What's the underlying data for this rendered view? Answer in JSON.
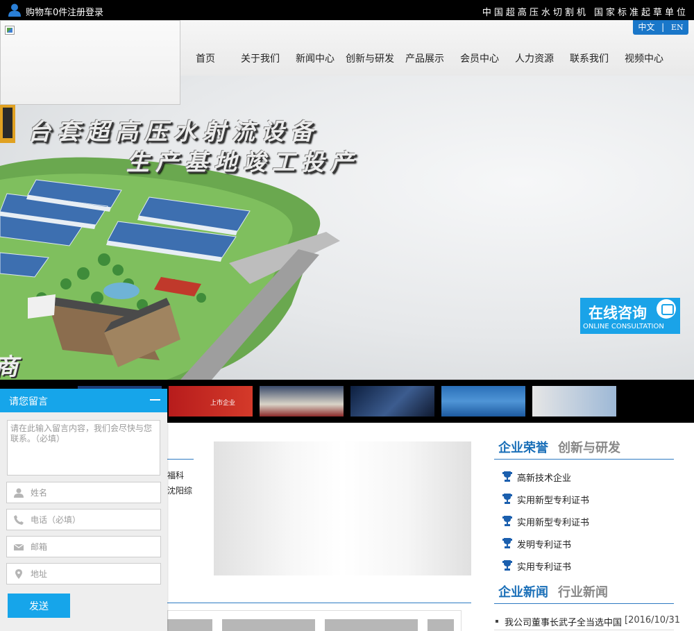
{
  "topbar": {
    "cart": "购物车0件",
    "login": "注册登录",
    "slogan": "中国超高压水切割机 国家标准起草单位"
  },
  "lang": {
    "zh": "中文",
    "sep": "|",
    "en": "EN"
  },
  "nav": {
    "items": [
      {
        "label": "首页"
      },
      {
        "label": "关于我们"
      },
      {
        "label": "新闻中心"
      },
      {
        "label": "创新与研发"
      },
      {
        "label": "产品展示"
      },
      {
        "label": "会员中心"
      },
      {
        "label": "人力资源"
      },
      {
        "label": "联系我们"
      },
      {
        "label": "视频中心"
      }
    ]
  },
  "hero": {
    "headline1": "台套超高压水射流设备",
    "headline2": "生产基地竣工投产",
    "edge_char": "商"
  },
  "consult": {
    "title": "在线咨询",
    "subtitle": "ONLINE CONSULTATION"
  },
  "strip": {
    "thumbs": [
      {
        "label": ""
      },
      {
        "label": "上市企业"
      },
      {
        "label": ""
      },
      {
        "label": ""
      },
      {
        "label": ""
      },
      {
        "label": ""
      }
    ]
  },
  "honors": {
    "tab_active": "企业荣誉",
    "tab_other": "创新与研发",
    "items": [
      "高新技术企业",
      "实用新型专利证书",
      "实用新型专利证书",
      "发明专利证书",
      "实用专利证书"
    ]
  },
  "news": {
    "tab_active": "企业新闻",
    "tab_other": "行业新闻",
    "items": [
      {
        "title": "我公司董事长武子全当选中国",
        "date": "[2016/10/31"
      }
    ]
  },
  "mid": {
    "frag1": "福科",
    "frag2": "沈阳综"
  },
  "message": {
    "title": "请您留言",
    "content_placeholder": "请在此输入留言内容，我们会尽快与您联系。（必填）",
    "name_placeholder": "姓名",
    "phone_placeholder": "电话（必填）",
    "email_placeholder": "邮箱",
    "address_placeholder": "地址",
    "send_label": "发送"
  },
  "colors": {
    "accent": "#16a5ea",
    "nav_blue": "#1a6fb8",
    "topbar": "#000000"
  }
}
